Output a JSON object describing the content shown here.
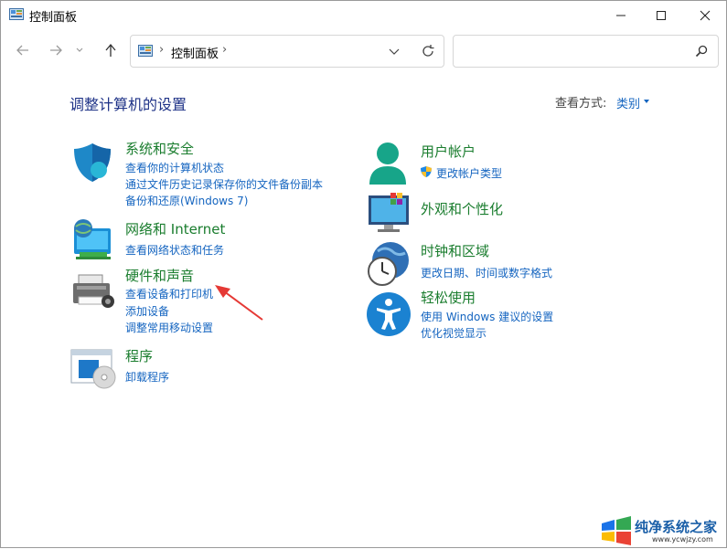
{
  "window": {
    "title": "控制面板"
  },
  "nav": {
    "breadcrumb": [
      "控制面板"
    ],
    "separator": "›",
    "search_placeholder": ""
  },
  "header": {
    "title": "调整计算机的设置",
    "view_by_label": "查看方式:",
    "view_by_value": "类别"
  },
  "categories": {
    "security": {
      "title": "系统和安全",
      "links": [
        "查看你的计算机状态",
        "通过文件历史记录保存你的文件备份副本",
        "备份和还原(Windows 7)"
      ],
      "icon": "shield-icon"
    },
    "network": {
      "title": "网络和 Internet",
      "links": [
        "查看网络状态和任务"
      ],
      "icon": "network-icon"
    },
    "hardware": {
      "title": "硬件和声音",
      "links": [
        "查看设备和打印机",
        "添加设备",
        "调整常用移动设置"
      ],
      "icon": "printer-icon"
    },
    "programs": {
      "title": "程序",
      "links": [
        "卸载程序"
      ],
      "icon": "programs-icon"
    },
    "accounts": {
      "title": "用户帐户",
      "links": [
        "更改帐户类型"
      ],
      "icon": "user-icon"
    },
    "appearance": {
      "title": "外观和个性化",
      "links": [],
      "icon": "monitor-icon"
    },
    "clock": {
      "title": "时钟和区域",
      "links": [
        "更改日期、时间或数字格式"
      ],
      "icon": "clock-globe-icon"
    },
    "ease": {
      "title": "轻松使用",
      "links": [
        "使用 Windows 建议的设置",
        "优化视觉显示"
      ],
      "icon": "accessibility-icon"
    }
  },
  "watermark": {
    "text": "纯净系统之家",
    "url": "www.ycwjzy.com"
  },
  "colors": {
    "title_blue": "#1e3287",
    "category_green": "#1a7d2e",
    "link_blue": "#1565c0",
    "annotation_red": "#e53935"
  }
}
